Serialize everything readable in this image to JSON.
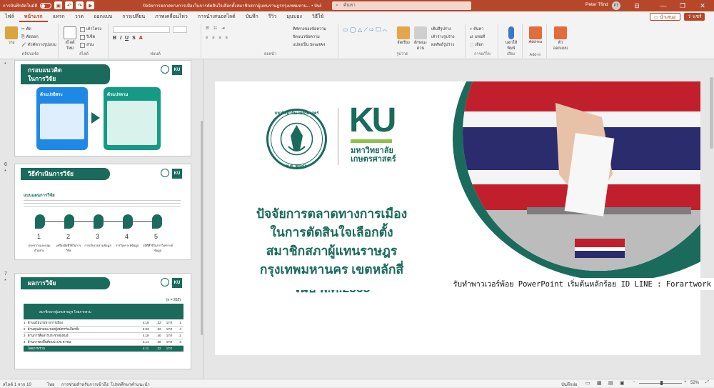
{
  "titlebar": {
    "autosave": "การบันทึกอัตโนมัติ",
    "doc_title": "ปัจจัยการตลาดทางการเมืองในการตัดสินใจเลือกตั้งสมาชิกสภาผู้แทนราษฎรกรุงเทพมหาน...  •  บันทึกไปยัง พีซีนี้ ∨",
    "search_placeholder": "ค้นหา",
    "user": "Peter Tfind",
    "initials": "PT",
    "minimize": "—",
    "restore": "❐",
    "close": "✕"
  },
  "menu": {
    "tabs": [
      "ไฟล์",
      "หน้าแรก",
      "แทรก",
      "วาด",
      "ออกแบบ",
      "การเปลี่ยน",
      "ภาพเคลื่อนไหว",
      "การนำเสนอสไลด์",
      "บันทึก",
      "รีวิว",
      "มุมมอง",
      "วิธีใช้"
    ],
    "present": "นำเสนอ",
    "share": "แชร์"
  },
  "ribbon": {
    "clipboard": {
      "paste": "วาง",
      "cut": "ตัด",
      "copy": "คัดลอก",
      "format": "ตัวคัดวางรูปแบบ",
      "group": "คลิปบอร์ด"
    },
    "slides": {
      "new": "สไลด์ใหม่",
      "layout": "เค้าโครง",
      "reset": "รีเซ็ต",
      "section": "ส่วน",
      "group": "สไลด์"
    },
    "font": {
      "group": "ฟอนต์"
    },
    "paragraph": {
      "direction": "ทิศทางของข้อความ",
      "align": "จัดแนวข้อความ",
      "smartart": "แปลงเป็น SmartArt",
      "group": "ย่อหน้า"
    },
    "drawing": {
      "arrange": "จัดเรียง",
      "quickstyles": "ลักษณะด่วน",
      "fill": "เติมสีรูปร่าง",
      "outline": "เค้าร่างรูปร่าง",
      "effects": "ผลลัพธ์รูปร่าง",
      "group": "รูปวาด"
    },
    "editing": {
      "find": "ค้นหา",
      "replace": "แทนที่",
      "select": "เลือก",
      "group": "การแก้ไข"
    },
    "voice": {
      "dictate": "บอกให้พิมพ์",
      "group": "เสียง"
    },
    "addins": {
      "label": "Add-ins",
      "group": "Add-in"
    },
    "designer": {
      "label": "ตัวออกแบบ"
    }
  },
  "thumbnails": [
    {
      "num": "",
      "title": "กรอบแนวคิด\nในการวิจัย",
      "left_label": "ตัวแปรอิสระ",
      "right_label": "ตัวแปรตาม"
    },
    {
      "num": "6",
      "title": "วิธีดำเนินการวิจัย",
      "sub": "แบบแผนการวิจัย",
      "steps": [
        "ประชากรและกลุ่มตัวอย่าง",
        "เครื่องมือที่ใช้ในการวิจัย",
        "การเก็บรวบรวมข้อมูล",
        "การวิเคราะห์ข้อมูล",
        "สถิติที่ใช้ในการวิเคราะห์ข้อมูล"
      ]
    },
    {
      "num": "7",
      "title": "ผลการวิจัย",
      "n": "(n = 252)",
      "header": "สมาชิกสภาผู้แทนราษฎร โดยภาพรวม",
      "rows": [
        [
          "1",
          "ด้านนโยบายทางการเมือง",
          "4.19",
          ".32",
          "มาก",
          "1"
        ],
        [
          "2",
          "ด้านคุณลักษณะของผู้สมัครรับเลือกตั้ง",
          "3.93",
          ".32",
          "มาก",
          "4"
        ],
        [
          "3",
          "ด้านการสื่อสารประชาสัมพันธ์",
          "4.19",
          ".40",
          "มาก",
          "2"
        ],
        [
          "4",
          "ด้านการลงพื้นที่พบปะประชาชน",
          "4.14",
          ".36",
          "มาก",
          "3"
        ]
      ],
      "total": [
        "โดยภาพรวม",
        "4.11",
        ".32",
        "มาก",
        ""
      ]
    }
  ],
  "slide": {
    "logo_text": "KU",
    "logo_sub1": "มหาวิทยาลัย",
    "logo_sub2": "เกษตรศาสตร์",
    "emblem_top": "มหาวิทยาลัยเกษตรศาสตร์",
    "emblem_year": "พ.ศ. ๒๔๘๖",
    "title_lines": [
      "ปัจจัยการตลาดทางการเมือง",
      "ในการตัดสินใจเลือกตั้ง",
      "สมาชิกสภาผู้แทนราษฎร",
      "กรุงเทพมหานคร เขตหลักสี่",
      "ในปี พ.ศ.2565"
    ],
    "watermark": "รับทำพาวเวอร์พ้อย PowerPoint เริ่มต้นหลักร้อย ID LINE : Forartwork"
  },
  "statusbar": {
    "slide_info": "สไลด์ 1 จาก 10",
    "lang": "ไทย",
    "accessibility": "การช่วยสำหรับการเข้าถึง: โปรดศึกษาคำแนะนำ",
    "notes": "บันทึกย่อ",
    "zoom": "52%"
  },
  "colors": {
    "brand": "#b7472a",
    "teal": "#1a6b5c",
    "kugreen": "#2e7d32",
    "lime": "#8bc34a"
  }
}
